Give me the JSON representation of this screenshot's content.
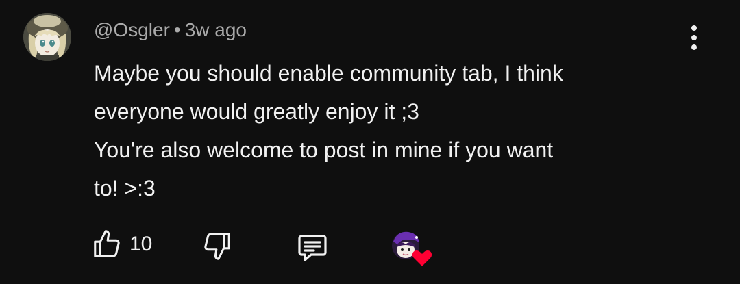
{
  "comment": {
    "author": "@Osgler",
    "separator": "•",
    "time": "3w ago",
    "lines": [
      "Maybe you should enable community tab, I think",
      "everyone would greatly enjoy it ;3",
      "You're also welcome to post in mine if you want",
      "to! >:3"
    ]
  },
  "actions": {
    "like_count": "10",
    "like_icon": "thumbs-up-icon",
    "dislike_icon": "thumbs-down-icon",
    "reply_icon": "reply-comment-icon",
    "creator_heart_icon": "creator-heart-icon",
    "menu_icon": "more-vertical-icon"
  },
  "colors": {
    "background": "#0f0f0f",
    "text": "#f1f1f1",
    "muted": "#aaaaaa",
    "heart": "#ff0033"
  }
}
